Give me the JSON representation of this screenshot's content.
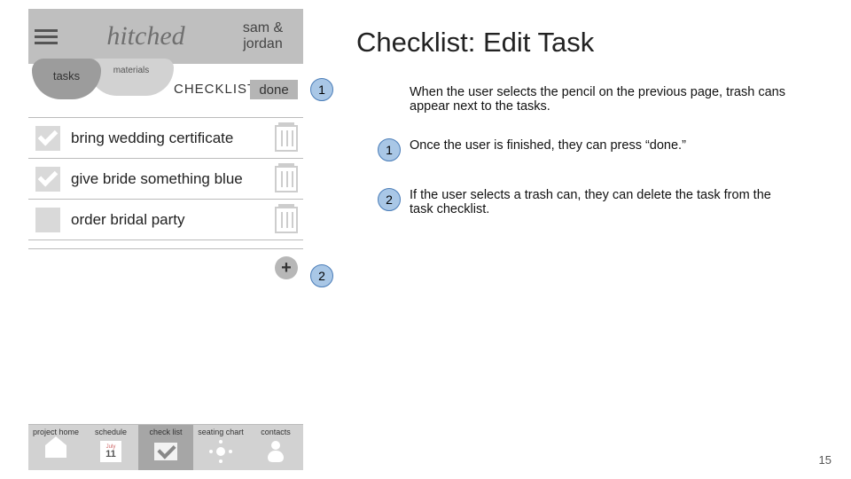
{
  "page_title": "Checklist: Edit Task",
  "page_number": "15",
  "app": {
    "title": "hitched",
    "couple_line1": "sam &",
    "couple_line2": "jordan"
  },
  "tabs": {
    "tasks": "tasks",
    "materials": "materials",
    "section": "CHECKLISTS",
    "done": "done"
  },
  "tasks": [
    {
      "label": "bring wedding certificate",
      "checked": true
    },
    {
      "label": "give  bride something blue",
      "checked": true
    },
    {
      "label": "order bridal party",
      "checked": false
    }
  ],
  "add_symbol": "+",
  "nav": {
    "items": [
      {
        "label": "project home"
      },
      {
        "label": "schedule",
        "cal_month": "July",
        "cal_day": "11"
      },
      {
        "label": "check list"
      },
      {
        "label": "seating chart"
      },
      {
        "label": "contacts"
      }
    ]
  },
  "intro": "When the user selects the pencil on the previous page, trash cans appear next to the tasks.",
  "annotations": [
    {
      "num": "1",
      "text": "Once the user is finished, they can press “done.”"
    },
    {
      "num": "2",
      "text": "If the user selects a trash can, they can delete the task from the task checklist."
    }
  ],
  "callouts": {
    "one": "1",
    "two": "2"
  }
}
